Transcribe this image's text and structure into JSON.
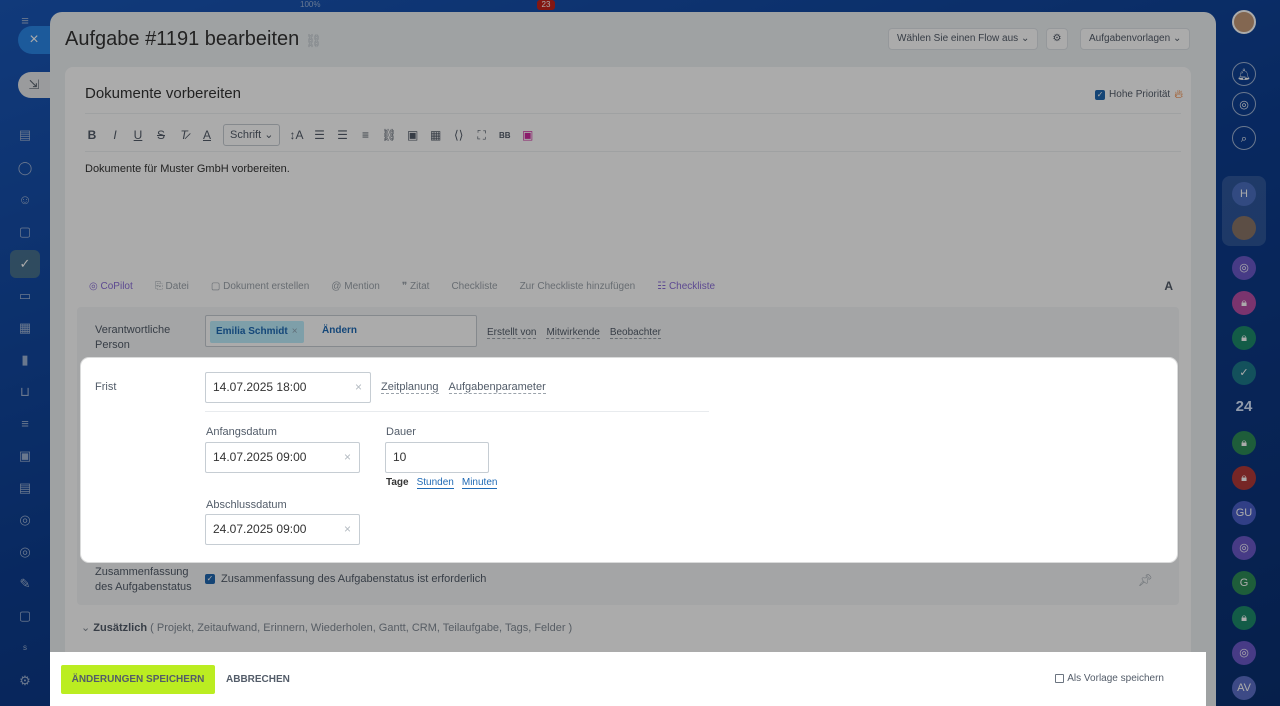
{
  "window": {
    "title": "Aufgabe #1191 bearbeiten",
    "flow_select": "Wählen Sie einen Flow aus",
    "templates_button": "Aufgabenvorlagen"
  },
  "background": {
    "zoom_text": "100%",
    "counter_badge": "23"
  },
  "task": {
    "name": "Dokumente vorbereiten",
    "priority_label": "Hohe Priorität",
    "priority_checked": true,
    "description": "Dokumente für Muster GmbH vorbereiten."
  },
  "toolbar": {
    "font_select": "Schrift",
    "icons": [
      "bold-icon",
      "italic-icon",
      "underline-icon",
      "strikethrough-icon",
      "clear-format-icon",
      "text-color-icon",
      "font-size-icon",
      "numbered-list-icon",
      "bullet-list-icon",
      "align-icon",
      "link-icon",
      "image-icon",
      "table-icon",
      "code-icon",
      "fullscreen-icon",
      "bbcode-icon",
      "media-icon"
    ],
    "bbcode_label": "BB"
  },
  "attachments": {
    "copilot": "CoPilot",
    "file": "Datei",
    "create_doc": "Dokument erstellen",
    "mention": "Mention",
    "quote": "Zitat",
    "checklist_text": "Checkliste",
    "add_to_checklist": "Zur Checkliste hinzufügen",
    "checklist": "Checkliste",
    "format_label": "A"
  },
  "responsible": {
    "label": "Verantwortliche Person",
    "person": "Emilia Schmidt",
    "remove_symbol": "×",
    "change_link": "Ändern",
    "created_by": "Erstellt von",
    "participants": "Mitwirkende",
    "observers": "Beobachter"
  },
  "deadline": {
    "label": "Frist",
    "value": "14.07.2025 18:00",
    "planning_link": "Zeitplanung",
    "params_link": "Aufgabenparameter",
    "start_label": "Anfangsdatum",
    "start_value": "14.07.2025 09:00",
    "duration_label": "Dauer",
    "duration_value": "10",
    "units": [
      "Tage",
      "Stunden",
      "Minuten"
    ],
    "end_label": "Abschlussdatum",
    "end_value": "24.07.2025 09:00"
  },
  "summary": {
    "label": "Zusammenfassung des Aufgabenstatus",
    "checkbox_text": "Zusammenfassung des Aufgabenstatus ist erforderlich",
    "checked": true
  },
  "additional": {
    "label": "Zusätzlich",
    "items_text": "( Projekt,  Zeitaufwand,  Erinnern,  Wiederholen,  Gantt,  CRM,  Teilaufgabe,  Tags,  Felder )"
  },
  "footer": {
    "save": "ÄNDERUNGEN SPEICHERN",
    "cancel": "ABBRECHEN",
    "save_template": "Als Vorlage speichern"
  },
  "right_bar": {
    "calendar_number": "24",
    "initials": [
      "H",
      "GU",
      "G",
      "AV"
    ]
  },
  "colors": {
    "save_button": "#bbed21",
    "accent_blue": "#2067b0",
    "chip_bg": "#bcedfc",
    "copilot_purple": "#8b6ed8"
  }
}
